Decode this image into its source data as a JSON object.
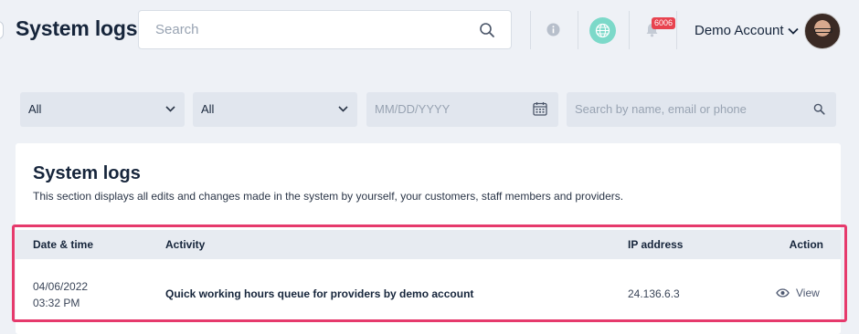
{
  "header": {
    "title": "System logs",
    "search_placeholder": "Search",
    "notification_count": "6006",
    "account_label": "Demo Account"
  },
  "filters": {
    "filter1_value": "All",
    "filter2_value": "All",
    "date_placeholder": "MM/DD/YYYY",
    "search_placeholder": "Search by name, email or phone"
  },
  "card": {
    "title": "System logs",
    "description": "This section displays all edits and changes made in the system by yourself, your customers, staff members and providers."
  },
  "table": {
    "columns": [
      "Date & time",
      "Activity",
      "IP address",
      "Action"
    ],
    "rows": [
      {
        "date": "04/06/2022",
        "time": "03:32 PM",
        "activity": "Quick working hours queue for providers by demo account",
        "ip": "24.136.6.3",
        "action": "View"
      }
    ]
  },
  "colors": {
    "background": "#eef1f6",
    "highlight": "#e63a6c",
    "badge": "#e8434f",
    "globe": "#7cd9c9"
  },
  "icons": [
    "search-icon",
    "info-icon",
    "globe-icon",
    "bell-icon",
    "chevron-down-icon",
    "calendar-icon",
    "eye-icon"
  ]
}
